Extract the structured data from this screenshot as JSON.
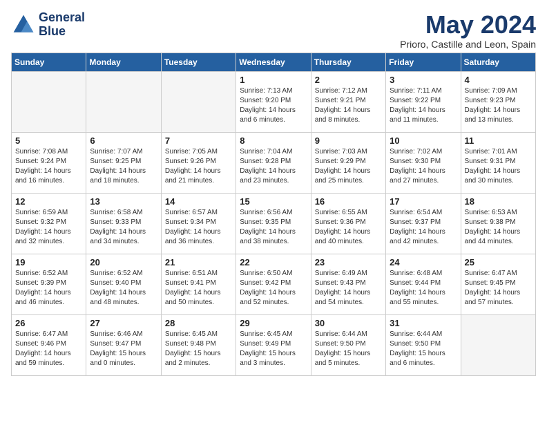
{
  "header": {
    "logo_line1": "General",
    "logo_line2": "Blue",
    "month_title": "May 2024",
    "location": "Prioro, Castille and Leon, Spain"
  },
  "weekdays": [
    "Sunday",
    "Monday",
    "Tuesday",
    "Wednesday",
    "Thursday",
    "Friday",
    "Saturday"
  ],
  "weeks": [
    [
      {
        "day": "",
        "info": ""
      },
      {
        "day": "",
        "info": ""
      },
      {
        "day": "",
        "info": ""
      },
      {
        "day": "1",
        "info": "Sunrise: 7:13 AM\nSunset: 9:20 PM\nDaylight: 14 hours\nand 6 minutes."
      },
      {
        "day": "2",
        "info": "Sunrise: 7:12 AM\nSunset: 9:21 PM\nDaylight: 14 hours\nand 8 minutes."
      },
      {
        "day": "3",
        "info": "Sunrise: 7:11 AM\nSunset: 9:22 PM\nDaylight: 14 hours\nand 11 minutes."
      },
      {
        "day": "4",
        "info": "Sunrise: 7:09 AM\nSunset: 9:23 PM\nDaylight: 14 hours\nand 13 minutes."
      }
    ],
    [
      {
        "day": "5",
        "info": "Sunrise: 7:08 AM\nSunset: 9:24 PM\nDaylight: 14 hours\nand 16 minutes."
      },
      {
        "day": "6",
        "info": "Sunrise: 7:07 AM\nSunset: 9:25 PM\nDaylight: 14 hours\nand 18 minutes."
      },
      {
        "day": "7",
        "info": "Sunrise: 7:05 AM\nSunset: 9:26 PM\nDaylight: 14 hours\nand 21 minutes."
      },
      {
        "day": "8",
        "info": "Sunrise: 7:04 AM\nSunset: 9:28 PM\nDaylight: 14 hours\nand 23 minutes."
      },
      {
        "day": "9",
        "info": "Sunrise: 7:03 AM\nSunset: 9:29 PM\nDaylight: 14 hours\nand 25 minutes."
      },
      {
        "day": "10",
        "info": "Sunrise: 7:02 AM\nSunset: 9:30 PM\nDaylight: 14 hours\nand 27 minutes."
      },
      {
        "day": "11",
        "info": "Sunrise: 7:01 AM\nSunset: 9:31 PM\nDaylight: 14 hours\nand 30 minutes."
      }
    ],
    [
      {
        "day": "12",
        "info": "Sunrise: 6:59 AM\nSunset: 9:32 PM\nDaylight: 14 hours\nand 32 minutes."
      },
      {
        "day": "13",
        "info": "Sunrise: 6:58 AM\nSunset: 9:33 PM\nDaylight: 14 hours\nand 34 minutes."
      },
      {
        "day": "14",
        "info": "Sunrise: 6:57 AM\nSunset: 9:34 PM\nDaylight: 14 hours\nand 36 minutes."
      },
      {
        "day": "15",
        "info": "Sunrise: 6:56 AM\nSunset: 9:35 PM\nDaylight: 14 hours\nand 38 minutes."
      },
      {
        "day": "16",
        "info": "Sunrise: 6:55 AM\nSunset: 9:36 PM\nDaylight: 14 hours\nand 40 minutes."
      },
      {
        "day": "17",
        "info": "Sunrise: 6:54 AM\nSunset: 9:37 PM\nDaylight: 14 hours\nand 42 minutes."
      },
      {
        "day": "18",
        "info": "Sunrise: 6:53 AM\nSunset: 9:38 PM\nDaylight: 14 hours\nand 44 minutes."
      }
    ],
    [
      {
        "day": "19",
        "info": "Sunrise: 6:52 AM\nSunset: 9:39 PM\nDaylight: 14 hours\nand 46 minutes."
      },
      {
        "day": "20",
        "info": "Sunrise: 6:52 AM\nSunset: 9:40 PM\nDaylight: 14 hours\nand 48 minutes."
      },
      {
        "day": "21",
        "info": "Sunrise: 6:51 AM\nSunset: 9:41 PM\nDaylight: 14 hours\nand 50 minutes."
      },
      {
        "day": "22",
        "info": "Sunrise: 6:50 AM\nSunset: 9:42 PM\nDaylight: 14 hours\nand 52 minutes."
      },
      {
        "day": "23",
        "info": "Sunrise: 6:49 AM\nSunset: 9:43 PM\nDaylight: 14 hours\nand 54 minutes."
      },
      {
        "day": "24",
        "info": "Sunrise: 6:48 AM\nSunset: 9:44 PM\nDaylight: 14 hours\nand 55 minutes."
      },
      {
        "day": "25",
        "info": "Sunrise: 6:47 AM\nSunset: 9:45 PM\nDaylight: 14 hours\nand 57 minutes."
      }
    ],
    [
      {
        "day": "26",
        "info": "Sunrise: 6:47 AM\nSunset: 9:46 PM\nDaylight: 14 hours\nand 59 minutes."
      },
      {
        "day": "27",
        "info": "Sunrise: 6:46 AM\nSunset: 9:47 PM\nDaylight: 15 hours\nand 0 minutes."
      },
      {
        "day": "28",
        "info": "Sunrise: 6:45 AM\nSunset: 9:48 PM\nDaylight: 15 hours\nand 2 minutes."
      },
      {
        "day": "29",
        "info": "Sunrise: 6:45 AM\nSunset: 9:49 PM\nDaylight: 15 hours\nand 3 minutes."
      },
      {
        "day": "30",
        "info": "Sunrise: 6:44 AM\nSunset: 9:50 PM\nDaylight: 15 hours\nand 5 minutes."
      },
      {
        "day": "31",
        "info": "Sunrise: 6:44 AM\nSunset: 9:50 PM\nDaylight: 15 hours\nand 6 minutes."
      },
      {
        "day": "",
        "info": ""
      }
    ]
  ]
}
